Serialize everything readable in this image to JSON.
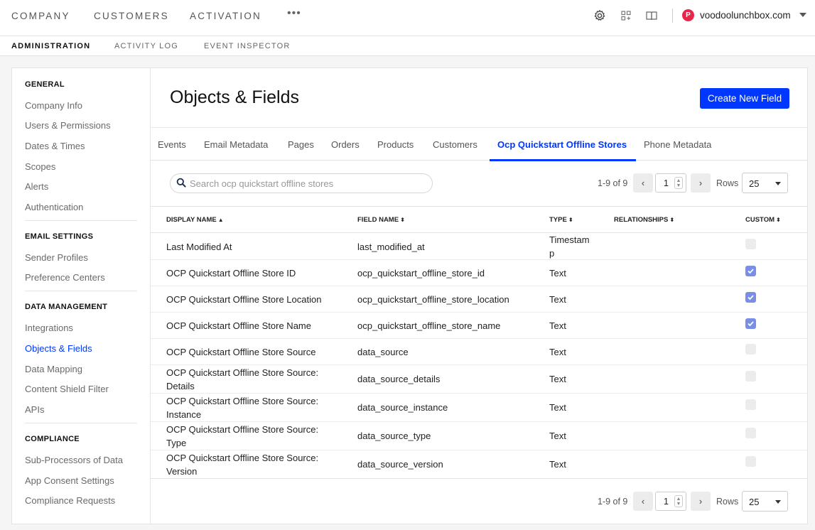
{
  "topnav": {
    "items": [
      "COMPANY",
      "CUSTOMERS",
      "ACTIVATION"
    ],
    "more": "•••",
    "avatar_letter": "P",
    "account": "voodoolunchbox.com"
  },
  "subnav": {
    "items": [
      "ADMINISTRATION",
      "ACTIVITY LOG",
      "EVENT INSPECTOR"
    ],
    "active": "ADMINISTRATION"
  },
  "sidebar": {
    "sections": [
      {
        "heading": "GENERAL",
        "items": [
          "Company Info",
          "Users & Permissions",
          "Dates & Times",
          "Scopes",
          "Alerts",
          "Authentication"
        ]
      },
      {
        "heading": "EMAIL SETTINGS",
        "items": [
          "Sender Profiles",
          "Preference Centers"
        ]
      },
      {
        "heading": "DATA MANAGEMENT",
        "items": [
          "Integrations",
          "Objects & Fields",
          "Data Mapping",
          "Content Shield Filter",
          "APIs"
        ]
      },
      {
        "heading": "COMPLIANCE",
        "items": [
          "Sub-Processors of Data",
          "App Consent Settings",
          "Compliance Requests"
        ]
      }
    ],
    "active_item": "Objects & Fields"
  },
  "main": {
    "title": "Objects & Fields",
    "create_label": "Create New Field",
    "tabs": [
      "Events",
      "Email Metadata",
      "Pages",
      "Orders",
      "Products",
      "Customers",
      "Ocp Quickstart Offline Stores",
      "Phone Metadata"
    ],
    "active_tab": "Ocp Quickstart Offline Stores",
    "search_placeholder": "Search ocp quickstart offline stores",
    "pager": {
      "range": "1-9 of 9",
      "page": "1",
      "rows_label": "Rows",
      "rows_value": "25"
    },
    "columns": [
      {
        "label": "DISPLAY NAME",
        "sort": "▲"
      },
      {
        "label": "FIELD NAME",
        "sort": "⬍"
      },
      {
        "label": "TYPE",
        "sort": "⬍"
      },
      {
        "label": "RELATIONSHIPS",
        "sort": "⬍"
      },
      {
        "label": "CUSTOM",
        "sort": "⬍"
      }
    ],
    "rows": [
      {
        "display": [
          "Last Modified At"
        ],
        "field": "last_modified_at",
        "type": [
          "Timestam",
          "p"
        ],
        "custom": false
      },
      {
        "display": [
          "OCP Quickstart Offline Store ID"
        ],
        "field": "ocp_quickstart_offline_store_id",
        "type": [
          "Text"
        ],
        "custom": true
      },
      {
        "display": [
          "OCP Quickstart Offline Store Location"
        ],
        "field": "ocp_quickstart_offline_store_location",
        "type": [
          "Text"
        ],
        "custom": true
      },
      {
        "display": [
          "OCP Quickstart Offline Store Name"
        ],
        "field": "ocp_quickstart_offline_store_name",
        "type": [
          "Text"
        ],
        "custom": true
      },
      {
        "display": [
          "OCP Quickstart Offline Store Source"
        ],
        "field": "data_source",
        "type": [
          "Text"
        ],
        "custom": false
      },
      {
        "display": [
          "OCP Quickstart Offline Store Source:",
          "Details"
        ],
        "field": "data_source_details",
        "type": [
          "Text"
        ],
        "custom": false
      },
      {
        "display": [
          "OCP Quickstart Offline Store Source:",
          "Instance"
        ],
        "field": "data_source_instance",
        "type": [
          "Text"
        ],
        "custom": false
      },
      {
        "display": [
          "OCP Quickstart Offline Store Source:",
          "Type"
        ],
        "field": "data_source_type",
        "type": [
          "Text"
        ],
        "custom": false
      },
      {
        "display": [
          "OCP Quickstart Offline Store Source:",
          "Version"
        ],
        "field": "data_source_version",
        "type": [
          "Text"
        ],
        "custom": false
      }
    ]
  },
  "colors": {
    "accent": "#0037ff",
    "checkbox_on": "#7b8ee6",
    "avatar": "#e8254a"
  },
  "icons": [
    "settings-icon",
    "apps-icon",
    "book-icon",
    "search-icon",
    "chevron-left-icon",
    "chevron-right-icon",
    "caret-down-icon",
    "check-icon"
  ]
}
